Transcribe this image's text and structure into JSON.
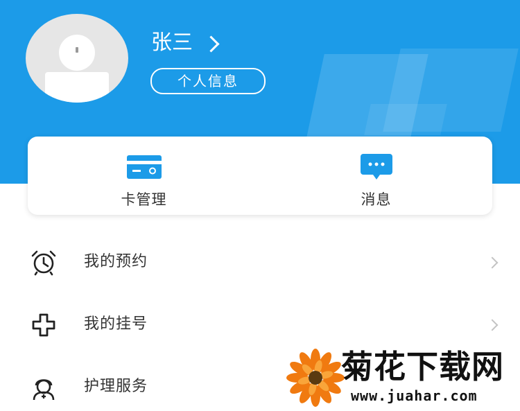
{
  "profile": {
    "name": "张三",
    "info_button": "个人信息"
  },
  "quick_actions": [
    {
      "label": "卡管理",
      "icon": "card-icon"
    },
    {
      "label": "消息",
      "icon": "message-icon"
    }
  ],
  "menu": [
    {
      "label": "我的预约",
      "icon": "alarm-clock-icon"
    },
    {
      "label": "我的挂号",
      "icon": "plus-cross-icon"
    },
    {
      "label": "护理服务",
      "icon": "nurse-icon"
    }
  ],
  "watermark": {
    "title": "菊花下载网",
    "url": "www.juahar.com"
  },
  "colors": {
    "header": "#1c9be8",
    "icon_blue": "#1c9be8",
    "text": "#333333"
  }
}
